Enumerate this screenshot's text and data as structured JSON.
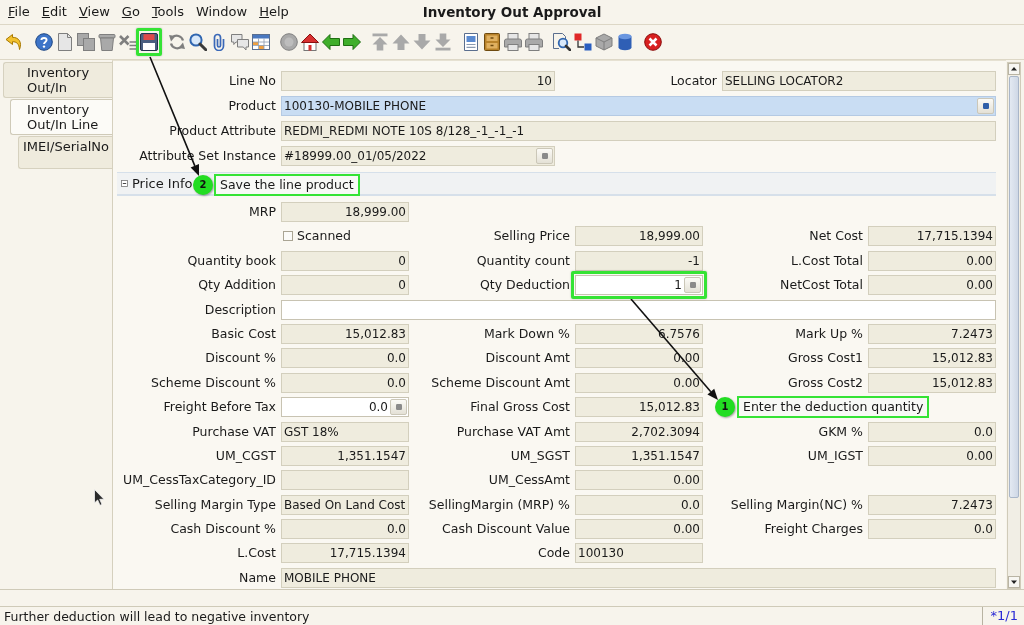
{
  "menu_bar": {
    "items": [
      {
        "label": "File",
        "mnemonic": true
      },
      {
        "label": "Edit",
        "mnemonic": true
      },
      {
        "label": "View",
        "mnemonic": true
      },
      {
        "label": "Go",
        "mnemonic": true
      },
      {
        "label": "Tools",
        "mnemonic": true
      },
      {
        "label": "Window",
        "mnemonic": false
      },
      {
        "label": "Help",
        "mnemonic": true
      }
    ]
  },
  "window": {
    "title": "Inventory Out Approval"
  },
  "toolbar": {
    "groups": [
      {
        "buttons": [
          {
            "kind": "undo",
            "disabled": false
          }
        ]
      },
      {
        "buttons": [
          {
            "kind": "help",
            "disabled": false
          },
          {
            "kind": "new",
            "disabled": true
          },
          {
            "kind": "copy",
            "disabled": true
          },
          {
            "kind": "delete",
            "disabled": true
          },
          {
            "kind": "deselect",
            "disabled": true
          },
          {
            "kind": "save",
            "disabled": false
          }
        ]
      },
      {
        "buttons": [
          {
            "kind": "refresh",
            "disabled": true
          },
          {
            "kind": "find",
            "disabled": false
          },
          {
            "kind": "attach",
            "disabled": false
          },
          {
            "kind": "chat",
            "disabled": true
          },
          {
            "kind": "grid",
            "disabled": false
          }
        ]
      },
      {
        "buttons": [
          {
            "kind": "history",
            "disabled": true
          },
          {
            "kind": "home",
            "disabled": false
          },
          {
            "kind": "back",
            "disabled": false
          },
          {
            "kind": "forward",
            "disabled": false
          }
        ]
      },
      {
        "buttons": [
          {
            "kind": "first",
            "disabled": true
          },
          {
            "kind": "previous",
            "disabled": true
          },
          {
            "kind": "next",
            "disabled": true
          },
          {
            "kind": "last",
            "disabled": true
          }
        ]
      },
      {
        "buttons": [
          {
            "kind": "report",
            "disabled": false
          },
          {
            "kind": "archive",
            "disabled": false
          },
          {
            "kind": "preview",
            "disabled": true
          },
          {
            "kind": "print",
            "disabled": true
          }
        ]
      },
      {
        "buttons": [
          {
            "kind": "zoom",
            "disabled": false
          },
          {
            "kind": "workflow",
            "disabled": false
          },
          {
            "kind": "info",
            "disabled": true
          },
          {
            "kind": "cylinder",
            "disabled": false
          }
        ]
      },
      {
        "buttons": [
          {
            "kind": "exit",
            "disabled": false
          }
        ]
      }
    ]
  },
  "tabs": [
    {
      "label": "Inventory Out/In",
      "selected": false
    },
    {
      "label": "Inventory Out/In Line",
      "selected": true,
      "children": [
        {
          "label": "IMEI/SerialNo",
          "selected": false
        }
      ]
    }
  ],
  "header_form": {
    "rows": [
      {
        "fields": [
          {
            "label": "Line No",
            "kind": "number",
            "value": "10"
          },
          {
            "label": "Locator",
            "kind": "text",
            "value": "SELLING LOCATOR2"
          }
        ]
      },
      {
        "fields": [
          {
            "label": "Product",
            "kind": "search",
            "value": "100130-MOBILE PHONE"
          }
        ]
      },
      {
        "fields": [
          {
            "label": "Product Attribute",
            "kind": "text",
            "value": "REDMI_REDMI NOTE 10S 8/128_-1_-1_-1"
          }
        ]
      },
      {
        "fields": [
          {
            "label": "Attribute Set Instance",
            "kind": "lookup",
            "value": "#18999.00_01/05/2022"
          }
        ]
      }
    ]
  },
  "price_info": {
    "title": "Price Info",
    "expanded": true,
    "rows": [
      {
        "fields": [
          {
            "label": "MRP",
            "kind": "number",
            "value": "18,999.00"
          }
        ]
      },
      {
        "fields": [
          {
            "label": "Scanned",
            "kind": "check",
            "checked": false
          },
          {
            "label": "Selling Price",
            "kind": "number",
            "value": "18,999.00"
          },
          {
            "label": "Net Cost",
            "kind": "number",
            "value": "17,715.1394"
          }
        ]
      },
      {
        "fields": [
          {
            "label": "Quantity book",
            "kind": "number",
            "value": "0"
          },
          {
            "label": "Quantity count",
            "kind": "number",
            "value": "-1"
          },
          {
            "label": "L.Cost Total",
            "kind": "number",
            "value": "0.00"
          }
        ]
      },
      {
        "fields": [
          {
            "label": "Qty Addition",
            "kind": "number",
            "value": "0"
          },
          {
            "label": "Qty Deduction",
            "kind": "input",
            "value": "1"
          },
          {
            "label": "NetCost Total",
            "kind": "number",
            "value": "0.00"
          }
        ]
      },
      {
        "fields": [
          {
            "label": "Description",
            "kind": "memo"
          }
        ]
      },
      {
        "fields": [
          {
            "label": "Basic Cost",
            "kind": "number",
            "value": "15,012.83"
          },
          {
            "label": "Mark Down %",
            "kind": "number",
            "value": "6.7576"
          },
          {
            "label": "Mark Up %",
            "kind": "number",
            "value": "7.2473"
          }
        ]
      },
      {
        "fields": [
          {
            "label": "Discount %",
            "kind": "number",
            "value": "0.0"
          },
          {
            "label": "Discount Amt",
            "kind": "number",
            "value": "0.00"
          },
          {
            "label": "Gross Cost1",
            "kind": "number",
            "value": "15,012.83"
          }
        ]
      },
      {
        "fields": [
          {
            "label": "Scheme Discount %",
            "kind": "number",
            "value": "0.0"
          },
          {
            "label": "Scheme Discount Amt",
            "kind": "number",
            "value": "0.00"
          },
          {
            "label": "Gross Cost2",
            "kind": "number",
            "value": "15,012.83"
          }
        ]
      },
      {
        "fields": [
          {
            "label": "Freight Before Tax",
            "kind": "input",
            "value": "0.0"
          },
          {
            "label": "Final Gross Cost",
            "kind": "number",
            "value": "15,012.83"
          }
        ]
      },
      {
        "fields": [
          {
            "label": "Purchase VAT",
            "kind": "text",
            "value": "GST 18%"
          },
          {
            "label": "Purchase VAT Amt",
            "kind": "number",
            "value": "2,702.3094"
          },
          {
            "label": "GKM %",
            "kind": "number",
            "value": "0.0"
          }
        ]
      },
      {
        "fields": [
          {
            "label": "UM_CGST",
            "kind": "number",
            "value": "1,351.1547"
          },
          {
            "label": "UM_SGST",
            "kind": "number",
            "value": "1,351.1547"
          },
          {
            "label": "UM_IGST",
            "kind": "number",
            "value": "0.00"
          }
        ]
      },
      {
        "fields": [
          {
            "label": "UM_CessTaxCategory_ID",
            "kind": "text"
          },
          {
            "label": "UM_CessAmt",
            "kind": "number",
            "value": "0.00"
          }
        ]
      },
      {
        "fields": [
          {
            "label": "Selling Margin Type",
            "kind": "text",
            "value": "Based On Land Cost"
          },
          {
            "label": "SellingMargin (MRP) %",
            "kind": "number",
            "value": "0.0"
          },
          {
            "label": "Selling Margin(NC) %",
            "kind": "number",
            "value": "7.2473"
          }
        ]
      },
      {
        "fields": [
          {
            "label": "Cash Discount %",
            "kind": "number",
            "value": "0.0"
          },
          {
            "label": "Cash Discount Value",
            "kind": "number",
            "value": "0.00"
          },
          {
            "label": "Freight Charges",
            "kind": "number",
            "value": "0.0"
          }
        ]
      },
      {
        "fields": [
          {
            "label": "L.Cost",
            "kind": "number",
            "value": "17,715.1394"
          },
          {
            "label": "Code",
            "kind": "text",
            "value": "100130"
          }
        ]
      },
      {
        "fields": [
          {
            "label": "Name",
            "kind": "text",
            "value": "MOBILE PHONE"
          }
        ]
      }
    ]
  },
  "callouts": [
    {
      "number": "2",
      "text": "Save the line product"
    },
    {
      "number": "1",
      "text": "Enter the deduction quantity"
    }
  ],
  "status_bar": {
    "message": "Further deduction will lead to negative inventory",
    "record_counter": "*1/1"
  }
}
